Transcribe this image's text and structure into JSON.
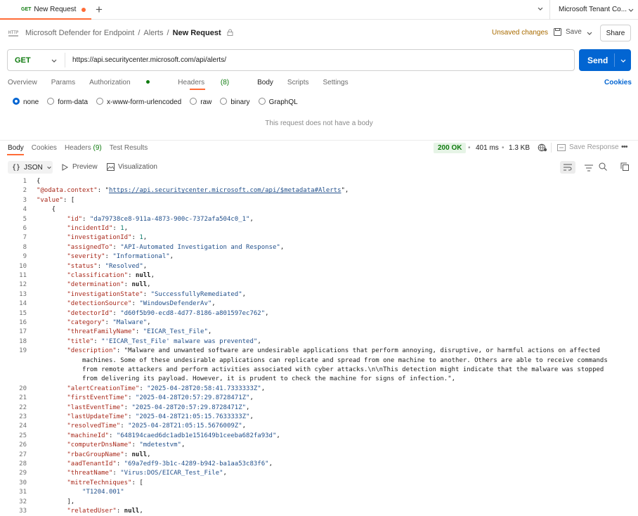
{
  "tab": {
    "method": "GET",
    "title": "New Request"
  },
  "tenant": "Microsoft Tenant Co...",
  "breadcrumb": {
    "workspace": "Microsoft Defender for Endpoint",
    "sep": "/",
    "collection": "Alerts",
    "current": "New Request"
  },
  "header": {
    "unsaved": "Unsaved changes",
    "save": "Save",
    "share": "Share"
  },
  "request": {
    "method": "GET",
    "url": "https://api.securitycenter.microsoft.com/api/alerts/",
    "send": "Send"
  },
  "request_tabs": {
    "overview": "Overview",
    "params": "Params",
    "authorization": "Authorization",
    "headers": "Headers",
    "headers_count": "(8)",
    "body": "Body",
    "scripts": "Scripts",
    "settings": "Settings",
    "cookies": "Cookies"
  },
  "body_types": [
    "none",
    "form-data",
    "x-www-form-urlencoded",
    "raw",
    "binary",
    "GraphQL"
  ],
  "no_body_message": "This request does not have a body",
  "response_tabs": {
    "body": "Body",
    "cookies": "Cookies",
    "headers": "Headers",
    "headers_count": "(9)",
    "test_results": "Test Results"
  },
  "response_meta": {
    "status": "200 OK",
    "time": "401 ms",
    "size": "1.3 KB",
    "save_response": "Save Response"
  },
  "view": {
    "format": "JSON",
    "preview": "Preview",
    "visualization": "Visualization"
  },
  "code_lines": [
    {
      "n": "1",
      "t": "{"
    },
    {
      "n": "2",
      "t": "    \"@odata.context\": \"https://api.securitycenter.microsoft.com/api/$metadata#Alerts\","
    },
    {
      "n": "3",
      "t": "    \"value\": ["
    },
    {
      "n": "4",
      "t": "        {"
    },
    {
      "n": "5",
      "t": "            \"id\": \"da79738ce8-911a-4873-900c-7372afa504c0_1\","
    },
    {
      "n": "6",
      "t": "            \"incidentId\": 1,"
    },
    {
      "n": "7",
      "t": "            \"investigationId\": 1,"
    },
    {
      "n": "8",
      "t": "            \"assignedTo\": \"API-Automated Investigation and Response\","
    },
    {
      "n": "9",
      "t": "            \"severity\": \"Informational\","
    },
    {
      "n": "10",
      "t": "            \"status\": \"Resolved\","
    },
    {
      "n": "11",
      "t": "            \"classification\": null,"
    },
    {
      "n": "12",
      "t": "            \"determination\": null,"
    },
    {
      "n": "13",
      "t": "            \"investigationState\": \"SuccessfullyRemediated\","
    },
    {
      "n": "14",
      "t": "            \"detectionSource\": \"WindowsDefenderAv\","
    },
    {
      "n": "15",
      "t": "            \"detectorId\": \"d60f5b90-ecd8-4d77-8186-a801597ec762\","
    },
    {
      "n": "16",
      "t": "            \"category\": \"Malware\","
    },
    {
      "n": "17",
      "t": "            \"threatFamilyName\": \"EICAR_Test_File\","
    },
    {
      "n": "18",
      "t": "            \"title\": \"'EICAR_Test_File' malware was prevented\","
    },
    {
      "n": "19",
      "t": "            \"description\": \"Malware and unwanted software are undesirable applications that perform annoying, disruptive, or harmful actions on affected"
    },
    {
      "n": "",
      "t": "                machines. Some of these undesirable applications can replicate and spread from one machine to another. Others are able to receive commands"
    },
    {
      "n": "",
      "t": "                from remote attackers and perform activities associated with cyber attacks.\\n\\nThis detection might indicate that the malware was stopped"
    },
    {
      "n": "",
      "t": "                from delivering its payload. However, it is prudent to check the machine for signs of infection.\","
    },
    {
      "n": "20",
      "t": "            \"alertCreationTime\": \"2025-04-28T20:58:41.7333333Z\","
    },
    {
      "n": "21",
      "t": "            \"firstEventTime\": \"2025-04-28T20:57:29.8728471Z\","
    },
    {
      "n": "22",
      "t": "            \"lastEventTime\": \"2025-04-28T20:57:29.8728471Z\","
    },
    {
      "n": "23",
      "t": "            \"lastUpdateTime\": \"2025-04-28T21:05:15.7633333Z\","
    },
    {
      "n": "24",
      "t": "            \"resolvedTime\": \"2025-04-28T21:05:15.5676009Z\","
    },
    {
      "n": "25",
      "t": "            \"machineId\": \"648194caed6dc1adb1e151649b1ceeba682fa93d\","
    },
    {
      "n": "26",
      "t": "            \"computerDnsName\": \"mdetestvm\","
    },
    {
      "n": "27",
      "t": "            \"rbacGroupName\": null,"
    },
    {
      "n": "28",
      "t": "            \"aadTenantId\": \"69a7edf9-3b1c-4289-b942-ba1aa53c83f6\","
    },
    {
      "n": "29",
      "t": "            \"threatName\": \"Virus:DOS/EICAR_Test_File\","
    },
    {
      "n": "30",
      "t": "            \"mitreTechniques\": ["
    },
    {
      "n": "31",
      "t": "                \"T1204.001\""
    },
    {
      "n": "32",
      "t": "            ],"
    },
    {
      "n": "33",
      "t": "            \"relatedUser\": null,"
    }
  ],
  "colors": {
    "accent": "#ff6c37",
    "send": "#0265d2",
    "get": "#0f7b0f",
    "json_key": "#a8281a",
    "json_string": "#23518c",
    "status_ok": "#0f7b0f",
    "unsaved": "#a86b00"
  }
}
